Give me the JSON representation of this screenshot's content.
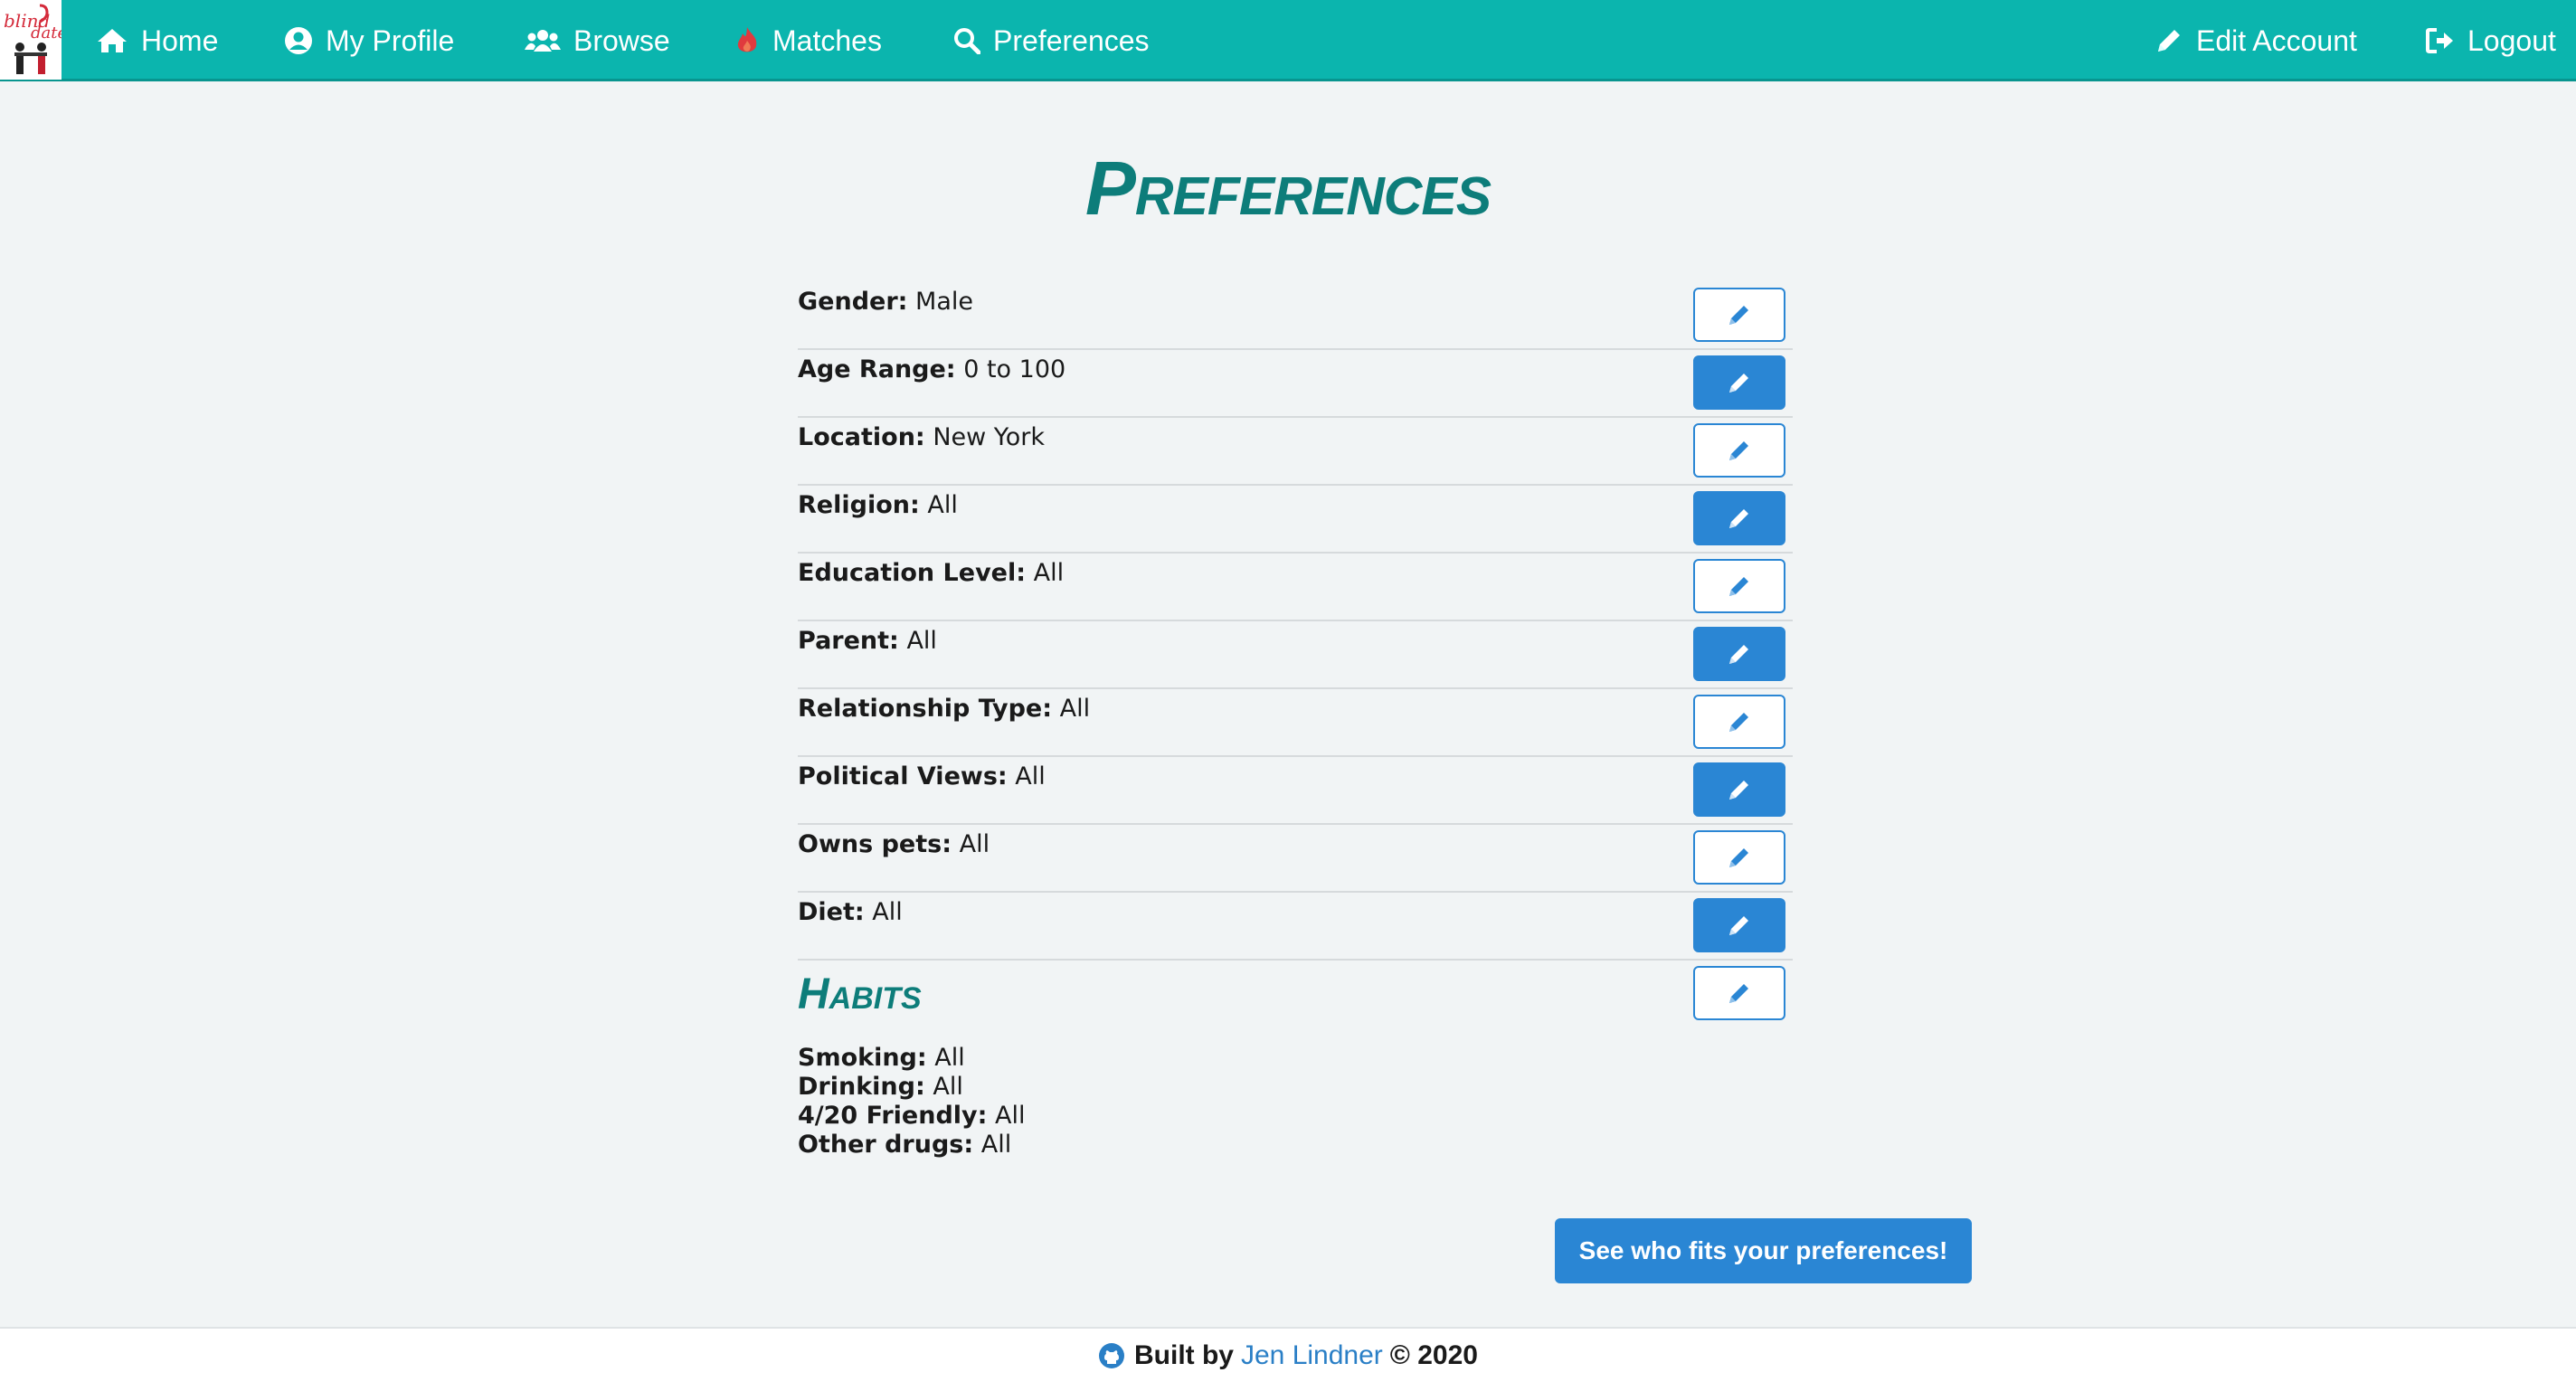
{
  "nav": {
    "logo_text": "blind date",
    "items": [
      {
        "label": "Home",
        "icon": "home-icon"
      },
      {
        "label": "My Profile",
        "icon": "user-circle-icon"
      },
      {
        "label": "Browse",
        "icon": "users-icon"
      },
      {
        "label": "Matches",
        "icon": "fire-icon"
      },
      {
        "label": "Preferences",
        "icon": "search-icon"
      }
    ],
    "right_items": [
      {
        "label": "Edit Account",
        "icon": "pencil-icon"
      },
      {
        "label": "Logout",
        "icon": "logout-icon"
      }
    ]
  },
  "page": {
    "title": "Preferences"
  },
  "preferences": [
    {
      "label": "Gender:",
      "value": "Male"
    },
    {
      "label": "Age Range:",
      "value": "0 to 100"
    },
    {
      "label": "Location:",
      "value": "New York"
    },
    {
      "label": "Religion:",
      "value": "All"
    },
    {
      "label": "Education Level:",
      "value": "All"
    },
    {
      "label": "Parent:",
      "value": "All"
    },
    {
      "label": "Relationship Type:",
      "value": "All"
    },
    {
      "label": "Political Views:",
      "value": "All"
    },
    {
      "label": "Owns pets:",
      "value": "All"
    },
    {
      "label": "Diet:",
      "value": "All"
    }
  ],
  "habits": {
    "title": "Habits",
    "items": [
      {
        "label": "Smoking:",
        "value": "All"
      },
      {
        "label": "Drinking:",
        "value": "All"
      },
      {
        "label": "4/20 Friendly:",
        "value": "All"
      },
      {
        "label": "Other drugs:",
        "value": "All"
      }
    ]
  },
  "cta_label": "See who fits your preferences!",
  "footer": {
    "prefix": "Built by",
    "author": "Jen Lindner",
    "suffix": "© 2020"
  },
  "colors": {
    "navbar": "#0bb5ae",
    "accent": "#2a86d4",
    "title": "#0d7d7a",
    "fire": "#e03a3e"
  }
}
